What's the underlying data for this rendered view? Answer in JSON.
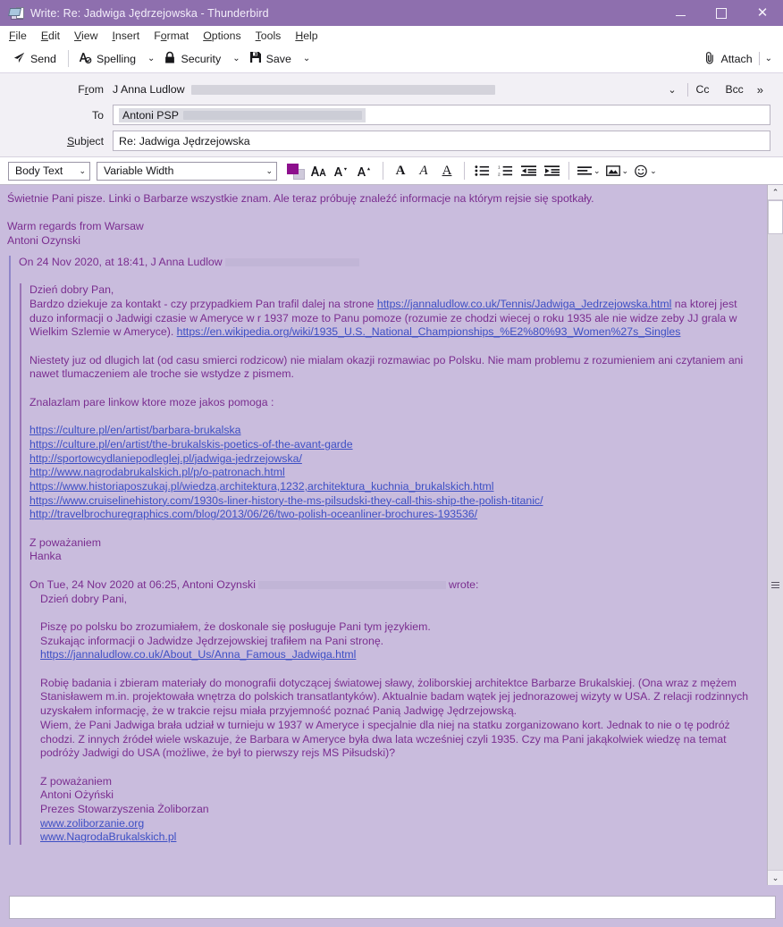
{
  "window": {
    "title": "Write: Re: Jadwiga Jędrzejowska - Thunderbird",
    "app_icon": "compose-mail-icon",
    "minimize": "–",
    "maximize": "□",
    "close": "✕",
    "titlebar_color": "#8e6fae"
  },
  "menubar": {
    "items": [
      {
        "pre": "",
        "accel": "F",
        "post": "ile"
      },
      {
        "pre": "",
        "accel": "E",
        "post": "dit"
      },
      {
        "pre": "",
        "accel": "V",
        "post": "iew"
      },
      {
        "pre": "",
        "accel": "I",
        "post": "nsert"
      },
      {
        "pre": "F",
        "accel": "o",
        "post": "rmat"
      },
      {
        "pre": "",
        "accel": "O",
        "post": "ptions"
      },
      {
        "pre": "",
        "accel": "T",
        "post": "ools"
      },
      {
        "pre": "",
        "accel": "H",
        "post": "elp"
      }
    ]
  },
  "toolbar": {
    "send_label": "Send",
    "spelling_label": "Spelling",
    "security_label": "Security",
    "save_label": "Save",
    "attach_label": "Attach",
    "caret": "⌄"
  },
  "headers": {
    "from_label_pre": "F",
    "from_label_accel": "r",
    "from_label_post": "om",
    "from_value": "J Anna Ludlow",
    "to_label": "To",
    "to_value": "Antoni PSP",
    "subject_label_pre": "",
    "subject_label_accel": "S",
    "subject_label_post": "ubject",
    "subject_value": "Re: Jadwiga Jędrzejowska",
    "cc_label": "Cc",
    "bcc_label": "Bcc",
    "expand_label": "»",
    "dropdown_caret": "⌄"
  },
  "format_toolbar": {
    "paragraph_style": "Body Text",
    "font_family": "Variable Width",
    "caret": "⌄",
    "color_swatch": "#8d0f8d",
    "buttons": [
      "text-color-swatch",
      "font-size-icon",
      "decrease-size-icon",
      "increase-size-icon",
      "bold-icon",
      "italic-icon",
      "underline-icon",
      "bullet-list-icon",
      "numbered-list-icon",
      "outdent-icon",
      "indent-icon",
      "align-icon",
      "insert-image-icon",
      "emoticon-icon"
    ]
  },
  "body": {
    "intro": "Świetnie Pani pisze. Linki o Barbarze wszystkie znam. Ale teraz próbuję znaleźć informacje na którym rejsie się spotkały.",
    "sign_line1": "Warm regards from Warsaw",
    "sign_line2": "Antoni Ozynski",
    "quote1_header": "On 24 Nov 2020, at 18:41, J Anna Ludlow",
    "q1_greeting": "Dzień dobry Pan,",
    "q1_p1_a": "Bardzo dziekuje za kontakt - czy przypadkiem Pan trafil dalej na strone ",
    "q1_p1_link1": "https://jannaludlow.co.uk/Tennis/Jadwiga_Jedrzejowska.html",
    "q1_p1_b": " na ktorej jest duzo informacji o Jadwigi czasie w Ameryce w r 1937 moze to Panu pomoze (rozumie ze chodzi wiecej o roku 1935 ale nie widze zeby JJ grala w Wielkim Szlemie w Ameryce). ",
    "q1_p1_link2": "https://en.wikipedia.org/wiki/1935_U.S._National_Championships_%E2%80%93_Women%27s_Singles",
    "q1_p2": "Niestety juz od dlugich lat (od casu smierci rodzicow) nie mialam okazji rozmawiac po Polsku. Nie mam problemu z rozumieniem ani czytaniem ani nawet tlumaczeniem ale troche sie wstydze z pismem.",
    "q1_p3": "Znalazlam pare linkow ktore moze jakos pomoga :",
    "q1_links": [
      "https://culture.pl/en/artist/barbara-brukalska",
      "https://culture.pl/en/artist/the-brukalskis-poetics-of-the-avant-garde",
      "http://sportowcydlaniepodleglej.pl/jadwiga-jedrzejowska/",
      "http://www.nagrodabrukalskich.pl/p/o-patronach.html",
      "https://www.historiaposzukaj.pl/wiedza,architektura,1232,architektura_kuchnia_brukalskich.html",
      "https://www.cruiselinehistory.com/1930s-liner-history-the-ms-pilsudski-they-call-this-ship-the-polish-titanic/",
      "http://travelbrochuregraphics.com/blog/2013/06/26/two-polish-oceanliner-brochures-193536/"
    ],
    "q1_sign1": "Z poważaniem",
    "q1_sign2": "Hanka",
    "quote2_header_a": "On Tue, 24 Nov 2020 at 06:25, Antoni Ozynski",
    "quote2_header_b": "wrote:",
    "q2_greeting": "Dzień dobry Pani,",
    "q2_p1_l1": "Piszę po polsku bo zrozumiałem, że doskonale się posługuje Pani tym językiem.",
    "q2_p1_l2": "Szukając informacji o Jadwidze Jędrzejowskiej trafiłem na Pani stronę.",
    "q2_link1": "https://jannaludlow.co.uk/About_Us/Anna_Famous_Jadwiga.html",
    "q2_p2": "Robię badania i zbieram materiały do monografii dotyczącej światowej sławy, żoliborskiej architektce Barbarze Brukalskiej.  (Ona wraz z mężem Stanisławem m.in. projektowała wnętrza do polskich transatlantyków). Aktualnie badam wątek jej jednorazowej wizyty w USA. Z relacji rodzinnych uzyskałem informację, że w trakcie rejsu miała przyjemność poznać Panią Jadwigę Jędrzejowską.",
    "q2_p3": "Wiem, że Pani Jadwiga brała udział w turnieju w 1937 w Ameryce i specjalnie dla niej na statku zorganizowano kort. Jednak to nie o tę podróż chodzi. Z innych źródeł wiele wskazuje, że Barbara w Ameryce była dwa lata wcześniej czyli 1935.  Czy ma Pani jakąkolwiek wiedzę na temat podróży Jadwigi do USA (możliwe, że był to pierwszy rejs MS Piłsudski)?",
    "q2_sign1": "Z poważaniem",
    "q2_sign2": "Antoni Ożyński",
    "q2_sign3": "Prezes Stowarzyszenia Żoliborzan",
    "q2_link2": "www.zoliborzanie.org",
    "q2_link3": "www.NagrodaBrukalskich.pl"
  },
  "scrollbar": {
    "up_arrow": "⌃",
    "down_arrow": "⌄"
  }
}
